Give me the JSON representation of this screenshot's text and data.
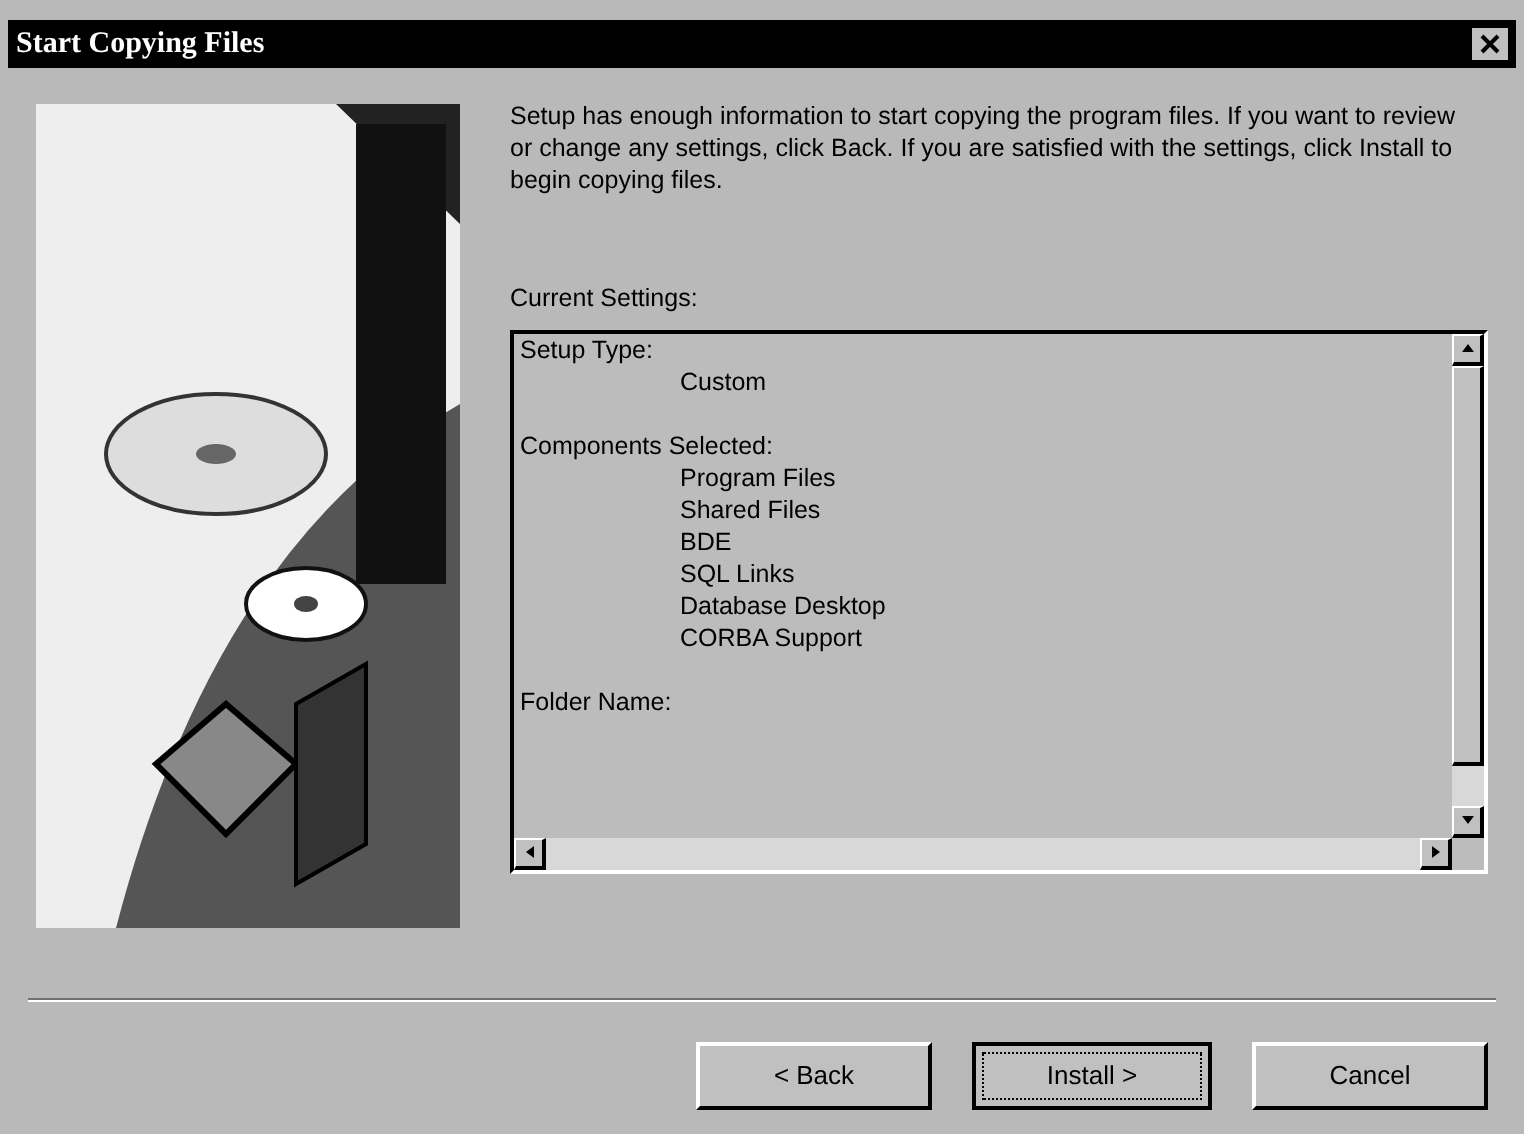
{
  "window": {
    "title": "Start Copying Files"
  },
  "intro": "Setup has enough information to start copying the program files. If you want to review or change any settings, click Back.  If you are satisfied with the settings, click Install to begin copying files.",
  "settings_label": "Current Settings:",
  "settings": [
    {
      "heading": "Setup Type:",
      "values": [
        "Custom"
      ]
    },
    {
      "heading": "Components Selected:",
      "values": [
        "Program Files",
        "Shared Files",
        "BDE",
        "SQL Links",
        "Database Desktop",
        "CORBA Support"
      ]
    },
    {
      "heading": "Folder Name:"
    }
  ],
  "buttons": [
    {
      "label": "< Back",
      "default": false
    },
    {
      "label": "Install >",
      "default": true
    },
    {
      "label": "Cancel",
      "default": false
    }
  ]
}
